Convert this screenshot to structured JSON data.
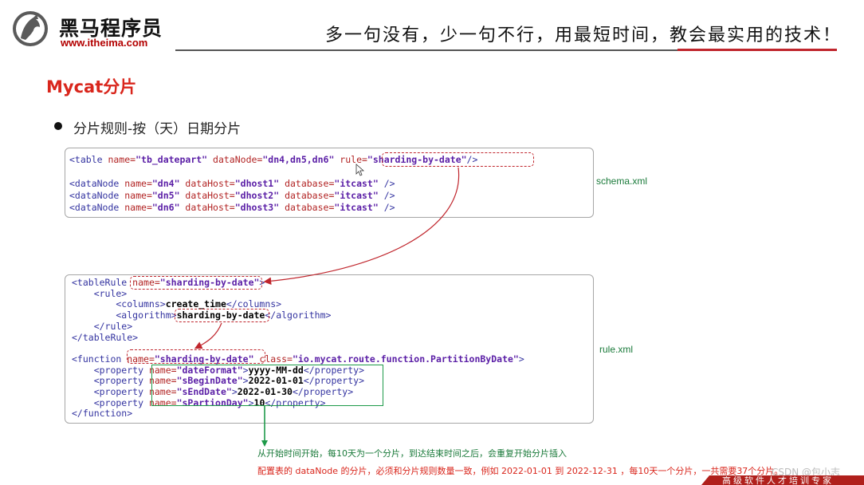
{
  "header": {
    "brand_name": "黑马程序员",
    "brand_url": "www.itheima.com",
    "slogan": "多一句没有，少一句不行，用最短时间，教会最实用的技术！"
  },
  "slide": {
    "title": "Mycat分片",
    "bullet": "分片规则-按（天）日期分片"
  },
  "schema_box": {
    "file_label": "schema.xml",
    "lines": [
      [
        [
          "tag",
          "<table "
        ],
        [
          "attr",
          "name="
        ],
        [
          "val",
          "\"tb_datepart\""
        ],
        [
          "attr",
          " dataNode="
        ],
        [
          "val",
          "\"dn4,dn5,dn6\""
        ],
        [
          "attr",
          " rule="
        ],
        [
          "val",
          "\"sharding-by-date\""
        ],
        [
          "tag",
          "/>"
        ]
      ],
      [],
      [
        [
          "tag",
          "<dataNode "
        ],
        [
          "attr",
          "name="
        ],
        [
          "val",
          "\"dn4\""
        ],
        [
          "attr",
          " dataHost="
        ],
        [
          "val",
          "\"dhost1\""
        ],
        [
          "attr",
          " database="
        ],
        [
          "val",
          "\"itcast\""
        ],
        [
          "tag",
          " />"
        ]
      ],
      [
        [
          "tag",
          "<dataNode "
        ],
        [
          "attr",
          "name="
        ],
        [
          "val",
          "\"dn5\""
        ],
        [
          "attr",
          " dataHost="
        ],
        [
          "val",
          "\"dhost2\""
        ],
        [
          "attr",
          " database="
        ],
        [
          "val",
          "\"itcast\""
        ],
        [
          "tag",
          " />"
        ]
      ],
      [
        [
          "tag",
          "<dataNode "
        ],
        [
          "attr",
          "name="
        ],
        [
          "val",
          "\"dn6\""
        ],
        [
          "attr",
          " dataHost="
        ],
        [
          "val",
          "\"dhost3\""
        ],
        [
          "attr",
          " database="
        ],
        [
          "val",
          "\"itcast\""
        ],
        [
          "tag",
          " />"
        ]
      ]
    ]
  },
  "rule_box": {
    "file_label": "rule.xml",
    "lines": [
      [
        [
          "tag",
          "<tableRule "
        ],
        [
          "attr",
          "name="
        ],
        [
          "val",
          "\"sharding-by-date\""
        ],
        [
          "tag",
          ">"
        ]
      ],
      [
        [
          "tag",
          "    <rule>"
        ]
      ],
      [
        [
          "tag",
          "        <columns>"
        ],
        [
          "txt",
          "create_time"
        ],
        [
          "tag",
          "</columns>"
        ]
      ],
      [
        [
          "tag",
          "        <algorithm>"
        ],
        [
          "txt",
          "sharding-by-date"
        ],
        [
          "tag",
          "</algorithm>"
        ]
      ],
      [
        [
          "tag",
          "    </rule>"
        ]
      ],
      [
        [
          "tag",
          "</tableRule>"
        ]
      ],
      [],
      [
        [
          "tag",
          "<function "
        ],
        [
          "attr",
          "name="
        ],
        [
          "val",
          "\"sharding-by-date\""
        ],
        [
          "attr",
          " class="
        ],
        [
          "val",
          "\"io.mycat.route.function.PartitionByDate\""
        ],
        [
          "tag",
          ">"
        ]
      ],
      [
        [
          "tag",
          "    <property "
        ],
        [
          "attr",
          "name="
        ],
        [
          "val",
          "\"dateFormat\""
        ],
        [
          "tag",
          ">"
        ],
        [
          "txt",
          "yyyy-MM-dd"
        ],
        [
          "tag",
          "</property>"
        ]
      ],
      [
        [
          "tag",
          "    <property "
        ],
        [
          "attr",
          "name="
        ],
        [
          "val",
          "\"sBeginDate\""
        ],
        [
          "tag",
          ">"
        ],
        [
          "txt",
          "2022-01-01"
        ],
        [
          "tag",
          "</property>"
        ]
      ],
      [
        [
          "tag",
          "    <property "
        ],
        [
          "attr",
          "name="
        ],
        [
          "val",
          "\"sEndDate\""
        ],
        [
          "tag",
          ">"
        ],
        [
          "txt",
          "2022-01-30"
        ],
        [
          "tag",
          "</property>"
        ]
      ],
      [
        [
          "tag",
          "    <property "
        ],
        [
          "attr",
          "name="
        ],
        [
          "val",
          "\"sPartionDay\""
        ],
        [
          "tag",
          ">"
        ],
        [
          "txt",
          "10"
        ],
        [
          "tag",
          "</property>"
        ]
      ],
      [
        [
          "tag",
          "</function>"
        ]
      ]
    ]
  },
  "notes": {
    "note1": "从开始时间开始，每10天为一个分片，到达结束时间之后，会重复开始分片插入",
    "note2": "配置表的 dataNode 的分片，必须和分片规则数量一致，例如 2022-01-01 到 2022-12-31 ，每10天一个分片，一共需要37个分片。"
  },
  "watermark": "CSDN @包小志",
  "footer": "高级软件人才培训专家",
  "colors": {
    "accent_red": "#d9261c",
    "highlight_green": "#1e9a49",
    "tag_blue": "#3333a0",
    "value_purple": "#5a1ea6"
  }
}
